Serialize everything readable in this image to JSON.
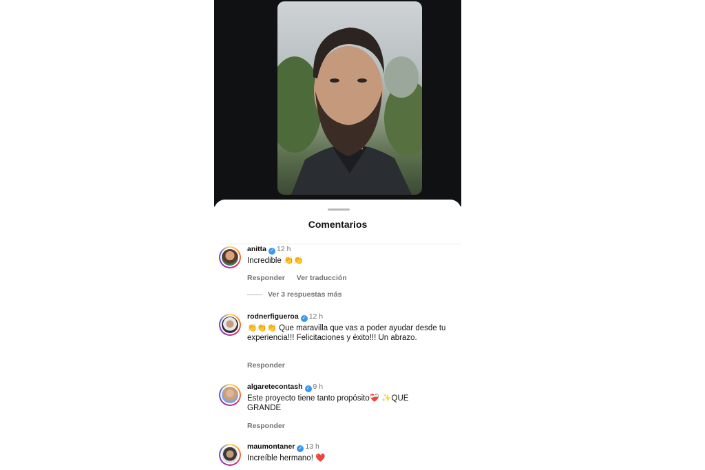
{
  "sheet": {
    "title": "Comentarios"
  },
  "comments": [
    {
      "username": "anitta",
      "time": "12 h",
      "text": "Incredible 👏👏",
      "reply_label": "Responder",
      "translate_label": "Ver traducción",
      "more_replies": "Ver 3 respuestas más"
    },
    {
      "username": "rodnerfigueroa",
      "time": "12 h",
      "text": "👏👏👏 Que maravilla que vas a poder ayudar desde tu experiencia!!! Felicitaciones y éxito!!! Un abrazo.",
      "reply_label": "Responder"
    },
    {
      "username": "algaretecontash",
      "time": "9 h",
      "text": "Este proyecto tiene tanto propósito❤️‍🩹 ✨QUE GRANDE",
      "reply_label": "Responder"
    },
    {
      "username": "maumontaner",
      "time": "13 h",
      "text": "Increíble hermano! ❤️"
    }
  ],
  "icons": {
    "verified": "verified-badge-icon",
    "avatar_ring": "story-ring"
  },
  "colors": {
    "verified": "#3897f0",
    "video_background": "#0f1113",
    "secondary_text": "#737373"
  }
}
